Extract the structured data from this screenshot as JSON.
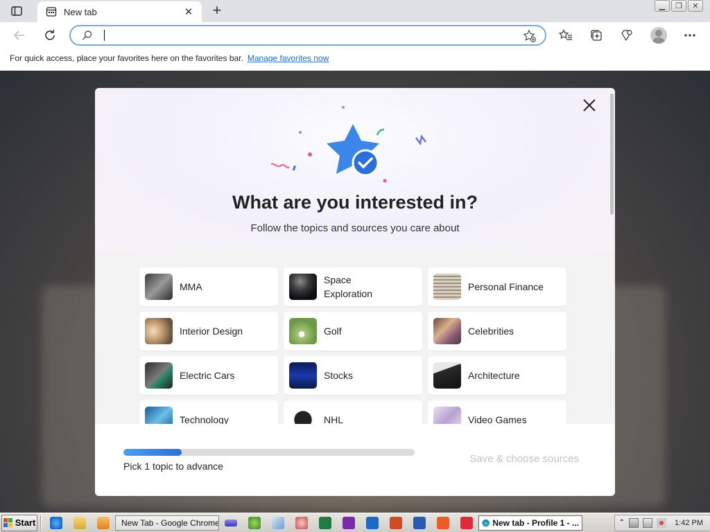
{
  "tab": {
    "title": "New tab"
  },
  "address_bar": {
    "value": "",
    "placeholder": ""
  },
  "favorites_bar": {
    "message": "For quick access, place your favorites here on the favorites bar.",
    "link": "Manage favorites now"
  },
  "modal": {
    "title": "What are you interested in?",
    "subtitle": "Follow the topics and sources you care about",
    "topics": [
      {
        "label": "MMA",
        "icon": "mma-thumbnail"
      },
      {
        "label": "Space Exploration",
        "icon": "space-thumbnail"
      },
      {
        "label": "Personal Finance",
        "icon": "finance-thumbnail"
      },
      {
        "label": "Interior Design",
        "icon": "interior-thumbnail"
      },
      {
        "label": "Golf",
        "icon": "golf-thumbnail"
      },
      {
        "label": "Celebrities",
        "icon": "celebrities-thumbnail"
      },
      {
        "label": "Electric Cars",
        "icon": "electric-cars-thumbnail"
      },
      {
        "label": "Stocks",
        "icon": "stocks-thumbnail"
      },
      {
        "label": "Architecture",
        "icon": "architecture-thumbnail"
      },
      {
        "label": "Technology",
        "icon": "technology-thumbnail"
      },
      {
        "label": "NHL",
        "icon": "nhl-thumbnail"
      },
      {
        "label": "Video Games",
        "icon": "video-games-thumbnail"
      }
    ],
    "progress": {
      "fraction": 0.2,
      "label": "Pick 1 topic to advance"
    },
    "save_button": "Save & choose sources"
  },
  "taskbar": {
    "start_label": "Start",
    "tasks": [
      {
        "label": "New Tab - Google Chrome",
        "active": false
      },
      {
        "label": "New tab - Profile 1 - ...",
        "active": true
      }
    ],
    "clock": "1:42 PM"
  },
  "colors": {
    "accent": "#2d6fdb",
    "address_border": "#7aa7d9",
    "link": "#1a6cd2"
  }
}
